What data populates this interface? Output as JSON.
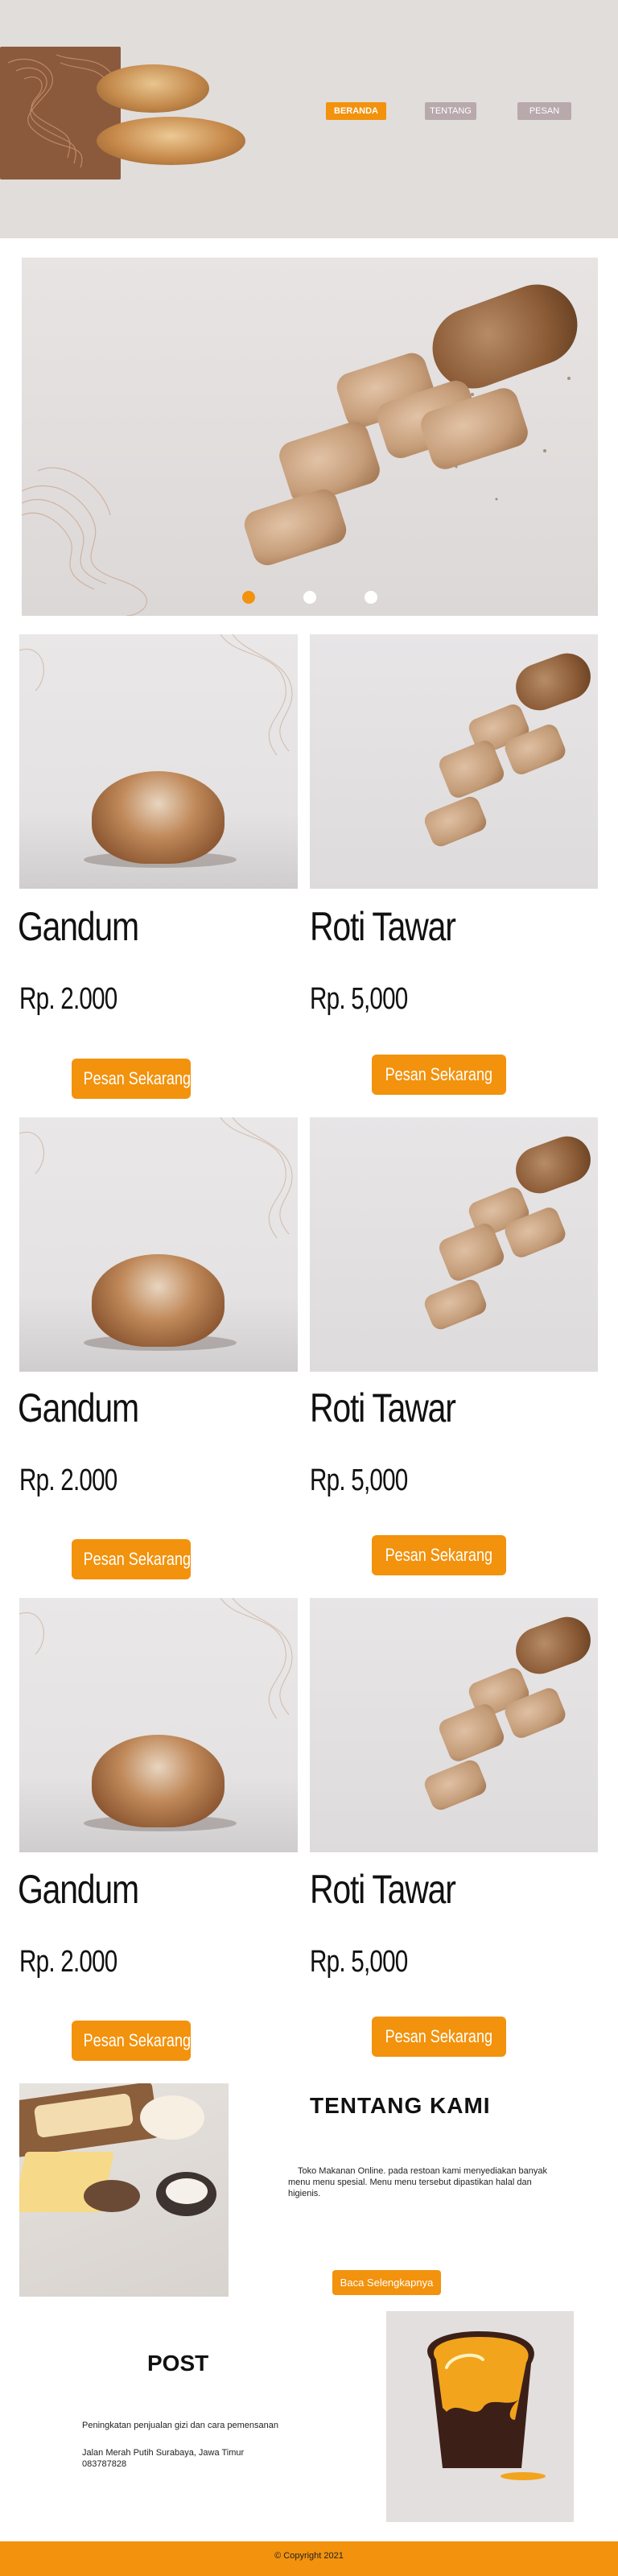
{
  "nav": {
    "home": "BERANDA",
    "about": "TENTANG",
    "order": "PESAN"
  },
  "carousel": {
    "dots": 3,
    "active_index": 0
  },
  "products": [
    {
      "name": "Gandum",
      "price": "Rp. 2.000",
      "button": "Pesan Sekarang"
    },
    {
      "name": "Roti Tawar",
      "price": "Rp. 5,000",
      "button": "Pesan Sekarang"
    },
    {
      "name": "Gandum",
      "price": "Rp. 2.000",
      "button": "Pesan Sekarang"
    },
    {
      "name": "Roti Tawar",
      "price": "Rp. 5,000",
      "button": "Pesan Sekarang"
    },
    {
      "name": "Gandum",
      "price": "Rp. 2.000",
      "button": "Pesan Sekarang"
    },
    {
      "name": "Roti Tawar",
      "price": "Rp. 5,000",
      "button": "Pesan Sekarang"
    }
  ],
  "about": {
    "title": "TENTANG KAMI",
    "text": "Toko Makanan Online. pada restoan kami menyediakan banyak menu menu spesial. Menu menu tersebut dipastikan halal dan higienis.",
    "button": "Baca Selengkapnya"
  },
  "post": {
    "title": "POST",
    "line1": "Peningkatan penjualan gizi dan cara pemensanan",
    "address": "Jalan Merah Putih Surabaya, Jawa Timur",
    "phone": "083787828"
  },
  "footer": {
    "copyright": "© Copyright 2021"
  },
  "colors": {
    "accent": "#f2920d",
    "nav_inactive": "#b8a9ad",
    "header_bg": "#e1dddb"
  }
}
